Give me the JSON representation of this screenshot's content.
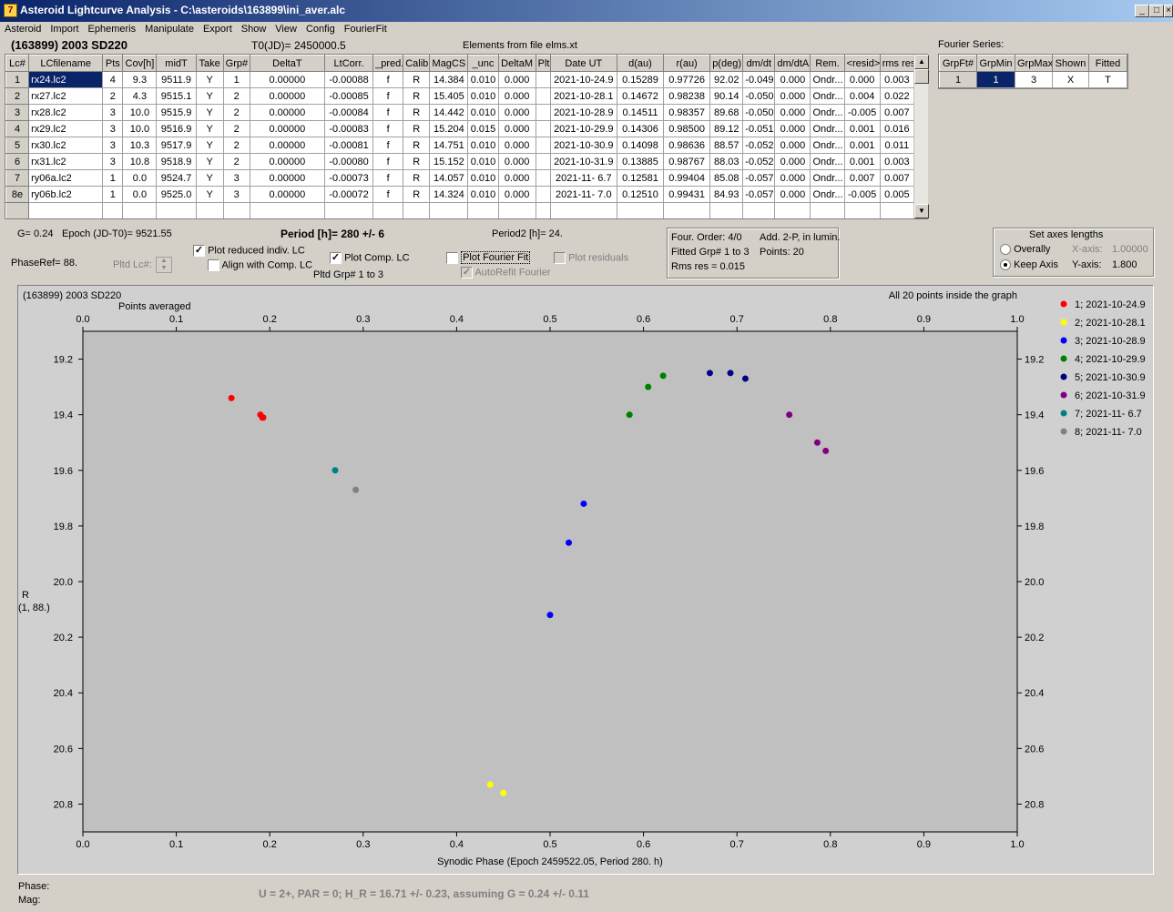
{
  "window": {
    "title": "Asteroid Lightcurve Analysis - C:\\asteroids\\163899\\ini_aver.alc",
    "icon_name": "app-logo-icon",
    "controls": [
      "minimize-icon",
      "maximize-icon",
      "close-icon"
    ]
  },
  "menu": [
    "Asteroid",
    "Import",
    "Ephemeris",
    "Manipulate",
    "Export",
    "Show",
    "View",
    "Config",
    "FourierFit"
  ],
  "header": {
    "asteroid_name": "(163899) 2003 SD220",
    "t0": "T0(JD)= 2450000.5",
    "elements": "Elements from file elms.xt"
  },
  "lc_table": {
    "columns": [
      "Lc#",
      "LCfilename",
      "Pts",
      "Cov[h]",
      "midT",
      "Take",
      "Grp#",
      "DeltaT",
      "LtCorr.",
      "_pred.",
      "Calib.",
      "MagCS",
      "_unc",
      "DeltaM",
      "Plt",
      "Date UT",
      "d(au)",
      "r(au)",
      "p(deg)",
      "dm/dt",
      "dm/dtA",
      "Rem.",
      "<resid>",
      "rms res"
    ],
    "rows": [
      [
        "1",
        "rx24.lc2",
        "4",
        "9.3",
        "9511.9",
        "Y",
        "1",
        "0.00000",
        "-0.00088",
        "f",
        "R",
        "14.384",
        "0.010",
        "0.000",
        "",
        "2021-10-24.9",
        "0.15289",
        "0.97726",
        "92.02",
        "-0.049",
        "0.000",
        "Ondr...",
        "0.000",
        "0.003"
      ],
      [
        "2",
        "rx27.lc2",
        "2",
        "4.3",
        "9515.1",
        "Y",
        "2",
        "0.00000",
        "-0.00085",
        "f",
        "R",
        "15.405",
        "0.010",
        "0.000",
        "",
        "2021-10-28.1",
        "0.14672",
        "0.98238",
        "90.14",
        "-0.050",
        "0.000",
        "Ondr...",
        "0.004",
        "0.022"
      ],
      [
        "3",
        "rx28.lc2",
        "3",
        "10.0",
        "9515.9",
        "Y",
        "2",
        "0.00000",
        "-0.00084",
        "f",
        "R",
        "14.442",
        "0.010",
        "0.000",
        "",
        "2021-10-28.9",
        "0.14511",
        "0.98357",
        "89.68",
        "-0.050",
        "0.000",
        "Ondr...",
        "-0.005",
        "0.007"
      ],
      [
        "4",
        "rx29.lc2",
        "3",
        "10.0",
        "9516.9",
        "Y",
        "2",
        "0.00000",
        "-0.00083",
        "f",
        "R",
        "15.204",
        "0.015",
        "0.000",
        "",
        "2021-10-29.9",
        "0.14306",
        "0.98500",
        "89.12",
        "-0.051",
        "0.000",
        "Ondr...",
        "0.001",
        "0.016"
      ],
      [
        "5",
        "rx30.lc2",
        "3",
        "10.3",
        "9517.9",
        "Y",
        "2",
        "0.00000",
        "-0.00081",
        "f",
        "R",
        "14.751",
        "0.010",
        "0.000",
        "",
        "2021-10-30.9",
        "0.14098",
        "0.98636",
        "88.57",
        "-0.052",
        "0.000",
        "Ondr...",
        "0.001",
        "0.011"
      ],
      [
        "6",
        "rx31.lc2",
        "3",
        "10.8",
        "9518.9",
        "Y",
        "2",
        "0.00000",
        "-0.00080",
        "f",
        "R",
        "15.152",
        "0.010",
        "0.000",
        "",
        "2021-10-31.9",
        "0.13885",
        "0.98767",
        "88.03",
        "-0.052",
        "0.000",
        "Ondr...",
        "0.001",
        "0.003"
      ],
      [
        "7",
        "ry06a.lc2",
        "1",
        "0.0",
        "9524.7",
        "Y",
        "3",
        "0.00000",
        "-0.00073",
        "f",
        "R",
        "14.057",
        "0.010",
        "0.000",
        "",
        "2021-11- 6.7",
        "0.12581",
        "0.99404",
        "85.08",
        "-0.057",
        "0.000",
        "Ondr...",
        "0.007",
        "0.007"
      ],
      [
        "8e",
        "ry06b.lc2",
        "1",
        "0.0",
        "9525.0",
        "Y",
        "3",
        "0.00000",
        "-0.00072",
        "f",
        "R",
        "14.324",
        "0.010",
        "0.000",
        "",
        "2021-11- 7.0",
        "0.12510",
        "0.99431",
        "84.93",
        "-0.057",
        "0.000",
        "Ondr...",
        "-0.005",
        "0.005"
      ]
    ]
  },
  "fourier_series": {
    "label": "Fourier Series:",
    "columns": [
      "GrpFt#",
      "GrpMin",
      "GrpMax",
      "Shown",
      "Fitted"
    ],
    "row": [
      "1",
      "1",
      "3",
      "X",
      "T"
    ]
  },
  "info": {
    "g": "G= 0.24",
    "epoch": "Epoch (JD-T0)= 9521.55",
    "period": "Period [h]= 280 +/- 6",
    "period2": "Period2 [h]= 24.",
    "phaseref": "PhaseRef= 88.",
    "pltd_lc": "Pltd Lc#:",
    "plot_reduced": "Plot reduced indiv. LC",
    "align_comp": "Align with Comp. LC",
    "plot_comp": "Plot Comp. LC",
    "pltd_grp": "Pltd Grp#  1   to   3",
    "plot_fourier": "Plot Fourier Fit",
    "autorefit": "AutoRefit Fourier",
    "plot_residuals": "Plot residuals"
  },
  "fourier_box": {
    "order": "Four. Order:  4/0",
    "add": "Add. 2-P, in lumin.",
    "fitted": "Fitted Grp# 1 to 3",
    "points": "Points: 20",
    "rms": "Rms res     = 0.015"
  },
  "axes_box": {
    "title": "Set axes lengths",
    "overally": "Overally",
    "keep_axis": "Keep Axis",
    "xaxis_label": "X-axis:",
    "xaxis_value": "1.00000",
    "yaxis_label": "Y-axis:",
    "yaxis_value": "1.800"
  },
  "status": {
    "phase": "Phase:",
    "mag": "Mag:",
    "bottom": "U = 2+, PAR = 0; H_R = 16.71 +/- 0.23, assuming G = 0.24 +/- 0.11"
  },
  "chart_data": {
    "type": "scatter",
    "title": "(163899) 2003 SD220",
    "subtitle": "Points averaged",
    "note": "All 20 points inside the graph",
    "xlabel": "Synodic Phase (Epoch 2459522.05, Period 280. h)",
    "ylabel": "R",
    "ylabel2": "(1, 88.)",
    "xlim": [
      0.0,
      1.0
    ],
    "ylim": [
      19.1,
      20.9
    ],
    "y_inverted": true,
    "xticks": [
      "0.0",
      "0.1",
      "0.2",
      "0.3",
      "0.4",
      "0.5",
      "0.6",
      "0.7",
      "0.8",
      "0.9",
      "1.0"
    ],
    "yticks": [
      "19.2",
      "19.4",
      "19.6",
      "19.8",
      "20.0",
      "20.2",
      "20.4",
      "20.6",
      "20.8"
    ],
    "grid": false,
    "legend_position": "right",
    "series": [
      {
        "name": "1; 2021-10-24.9",
        "color": "#ff0000",
        "points": [
          [
            0.159,
            19.34
          ],
          [
            0.19,
            19.4
          ],
          [
            0.192,
            19.41
          ],
          [
            0.193,
            19.41
          ]
        ]
      },
      {
        "name": "2; 2021-10-28.1",
        "color": "#ffff00",
        "points": [
          [
            0.436,
            20.73
          ],
          [
            0.45,
            20.76
          ]
        ]
      },
      {
        "name": "3; 2021-10-28.9",
        "color": "#0000ff",
        "points": [
          [
            0.5,
            20.12
          ],
          [
            0.52,
            19.86
          ],
          [
            0.536,
            19.72
          ]
        ]
      },
      {
        "name": "4; 2021-10-29.9",
        "color": "#008000",
        "points": [
          [
            0.585,
            19.4
          ],
          [
            0.605,
            19.3
          ],
          [
            0.621,
            19.26
          ]
        ]
      },
      {
        "name": "5; 2021-10-30.9",
        "color": "#000080",
        "points": [
          [
            0.671,
            19.25
          ],
          [
            0.693,
            19.25
          ],
          [
            0.709,
            19.27
          ]
        ]
      },
      {
        "name": "6; 2021-10-31.9",
        "color": "#800080",
        "points": [
          [
            0.756,
            19.4
          ],
          [
            0.786,
            19.5
          ],
          [
            0.795,
            19.53
          ]
        ]
      },
      {
        "name": "7; 2021-11- 6.7",
        "color": "#008080",
        "points": [
          [
            0.27,
            19.6
          ]
        ]
      },
      {
        "name": "8; 2021-11- 7.0",
        "color": "#808080",
        "points": [
          [
            0.292,
            19.67
          ]
        ]
      }
    ]
  }
}
